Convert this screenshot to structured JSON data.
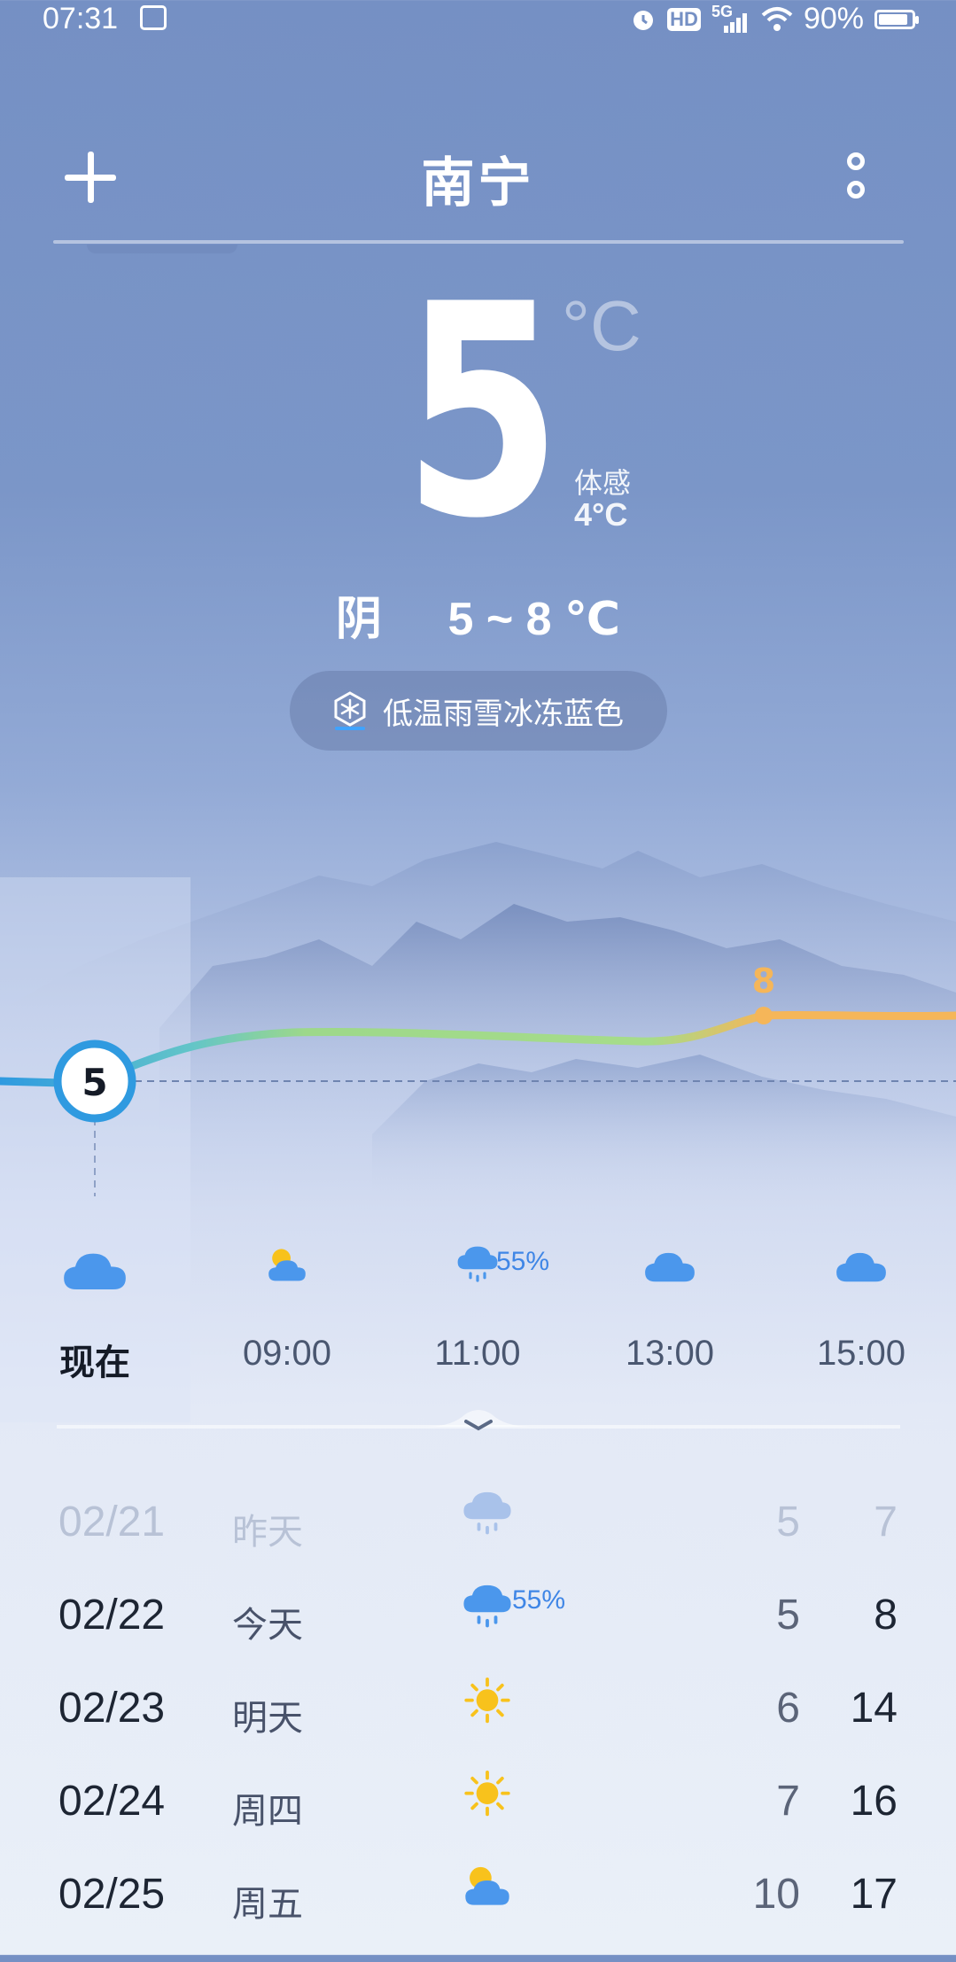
{
  "status_bar": {
    "time": "07:31",
    "network": "5G",
    "hd": "HD",
    "battery_text": "90%",
    "battery_level": 0.9
  },
  "header": {
    "city": "南宁",
    "add_icon": "plus-icon",
    "more_icon": "more-vertical-icon"
  },
  "current": {
    "temperature": "5",
    "unit": "°C",
    "feels_label": "体感",
    "feels_value": "4°C",
    "condition": "阴",
    "range": "5 ~ 8 ℃"
  },
  "alert": {
    "text": "低温雨雪冰冻蓝色",
    "icon": "snowflake-warning-icon"
  },
  "chart": {
    "now_temp_label": "5",
    "peak_label": "8",
    "temps": [
      5,
      6,
      7,
      7,
      7,
      8,
      8
    ],
    "colors": {
      "cold": "#2f9ae0",
      "mild": "#9dd88a",
      "warm": "#f5b659"
    }
  },
  "hourly": [
    {
      "label": "现在",
      "icon": "cloudy-icon",
      "pop": ""
    },
    {
      "label": "09:00",
      "icon": "partly-cloudy-icon",
      "pop": ""
    },
    {
      "label": "11:00",
      "icon": "rain-icon",
      "pop": "55%"
    },
    {
      "label": "13:00",
      "icon": "cloudy-icon",
      "pop": ""
    },
    {
      "label": "15:00",
      "icon": "cloudy-icon",
      "pop": ""
    }
  ],
  "daily": [
    {
      "date": "02/21",
      "name": "昨天",
      "icon": "rain-icon",
      "pop": "",
      "low": "5",
      "high": "7"
    },
    {
      "date": "02/22",
      "name": "今天",
      "icon": "rain-icon",
      "pop": "55%",
      "low": "5",
      "high": "8"
    },
    {
      "date": "02/23",
      "name": "明天",
      "icon": "sun-icon",
      "pop": "",
      "low": "6",
      "high": "14"
    },
    {
      "date": "02/24",
      "name": "周四",
      "icon": "sun-icon",
      "pop": "",
      "low": "7",
      "high": "16"
    },
    {
      "date": "02/25",
      "name": "周五",
      "icon": "partly-cloudy-icon",
      "pop": "",
      "low": "10",
      "high": "17"
    }
  ]
}
